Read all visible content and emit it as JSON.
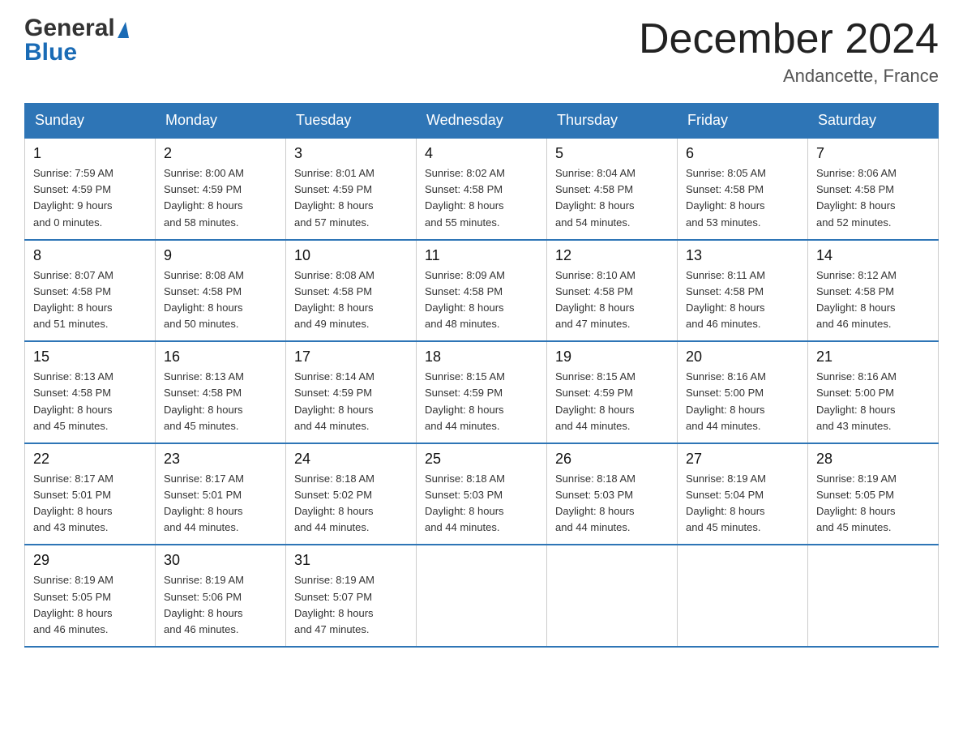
{
  "header": {
    "logo_general": "General",
    "logo_blue": "Blue",
    "month_title": "December 2024",
    "location": "Andancette, France"
  },
  "weekdays": [
    "Sunday",
    "Monday",
    "Tuesday",
    "Wednesday",
    "Thursday",
    "Friday",
    "Saturday"
  ],
  "weeks": [
    [
      {
        "day": "1",
        "sunrise": "7:59 AM",
        "sunset": "4:59 PM",
        "daylight": "9 hours and 0 minutes."
      },
      {
        "day": "2",
        "sunrise": "8:00 AM",
        "sunset": "4:59 PM",
        "daylight": "8 hours and 58 minutes."
      },
      {
        "day": "3",
        "sunrise": "8:01 AM",
        "sunset": "4:59 PM",
        "daylight": "8 hours and 57 minutes."
      },
      {
        "day": "4",
        "sunrise": "8:02 AM",
        "sunset": "4:58 PM",
        "daylight": "8 hours and 55 minutes."
      },
      {
        "day": "5",
        "sunrise": "8:04 AM",
        "sunset": "4:58 PM",
        "daylight": "8 hours and 54 minutes."
      },
      {
        "day": "6",
        "sunrise": "8:05 AM",
        "sunset": "4:58 PM",
        "daylight": "8 hours and 53 minutes."
      },
      {
        "day": "7",
        "sunrise": "8:06 AM",
        "sunset": "4:58 PM",
        "daylight": "8 hours and 52 minutes."
      }
    ],
    [
      {
        "day": "8",
        "sunrise": "8:07 AM",
        "sunset": "4:58 PM",
        "daylight": "8 hours and 51 minutes."
      },
      {
        "day": "9",
        "sunrise": "8:08 AM",
        "sunset": "4:58 PM",
        "daylight": "8 hours and 50 minutes."
      },
      {
        "day": "10",
        "sunrise": "8:08 AM",
        "sunset": "4:58 PM",
        "daylight": "8 hours and 49 minutes."
      },
      {
        "day": "11",
        "sunrise": "8:09 AM",
        "sunset": "4:58 PM",
        "daylight": "8 hours and 48 minutes."
      },
      {
        "day": "12",
        "sunrise": "8:10 AM",
        "sunset": "4:58 PM",
        "daylight": "8 hours and 47 minutes."
      },
      {
        "day": "13",
        "sunrise": "8:11 AM",
        "sunset": "4:58 PM",
        "daylight": "8 hours and 46 minutes."
      },
      {
        "day": "14",
        "sunrise": "8:12 AM",
        "sunset": "4:58 PM",
        "daylight": "8 hours and 46 minutes."
      }
    ],
    [
      {
        "day": "15",
        "sunrise": "8:13 AM",
        "sunset": "4:58 PM",
        "daylight": "8 hours and 45 minutes."
      },
      {
        "day": "16",
        "sunrise": "8:13 AM",
        "sunset": "4:58 PM",
        "daylight": "8 hours and 45 minutes."
      },
      {
        "day": "17",
        "sunrise": "8:14 AM",
        "sunset": "4:59 PM",
        "daylight": "8 hours and 44 minutes."
      },
      {
        "day": "18",
        "sunrise": "8:15 AM",
        "sunset": "4:59 PM",
        "daylight": "8 hours and 44 minutes."
      },
      {
        "day": "19",
        "sunrise": "8:15 AM",
        "sunset": "4:59 PM",
        "daylight": "8 hours and 44 minutes."
      },
      {
        "day": "20",
        "sunrise": "8:16 AM",
        "sunset": "5:00 PM",
        "daylight": "8 hours and 44 minutes."
      },
      {
        "day": "21",
        "sunrise": "8:16 AM",
        "sunset": "5:00 PM",
        "daylight": "8 hours and 43 minutes."
      }
    ],
    [
      {
        "day": "22",
        "sunrise": "8:17 AM",
        "sunset": "5:01 PM",
        "daylight": "8 hours and 43 minutes."
      },
      {
        "day": "23",
        "sunrise": "8:17 AM",
        "sunset": "5:01 PM",
        "daylight": "8 hours and 44 minutes."
      },
      {
        "day": "24",
        "sunrise": "8:18 AM",
        "sunset": "5:02 PM",
        "daylight": "8 hours and 44 minutes."
      },
      {
        "day": "25",
        "sunrise": "8:18 AM",
        "sunset": "5:03 PM",
        "daylight": "8 hours and 44 minutes."
      },
      {
        "day": "26",
        "sunrise": "8:18 AM",
        "sunset": "5:03 PM",
        "daylight": "8 hours and 44 minutes."
      },
      {
        "day": "27",
        "sunrise": "8:19 AM",
        "sunset": "5:04 PM",
        "daylight": "8 hours and 45 minutes."
      },
      {
        "day": "28",
        "sunrise": "8:19 AM",
        "sunset": "5:05 PM",
        "daylight": "8 hours and 45 minutes."
      }
    ],
    [
      {
        "day": "29",
        "sunrise": "8:19 AM",
        "sunset": "5:05 PM",
        "daylight": "8 hours and 46 minutes."
      },
      {
        "day": "30",
        "sunrise": "8:19 AM",
        "sunset": "5:06 PM",
        "daylight": "8 hours and 46 minutes."
      },
      {
        "day": "31",
        "sunrise": "8:19 AM",
        "sunset": "5:07 PM",
        "daylight": "8 hours and 47 minutes."
      },
      null,
      null,
      null,
      null
    ]
  ]
}
